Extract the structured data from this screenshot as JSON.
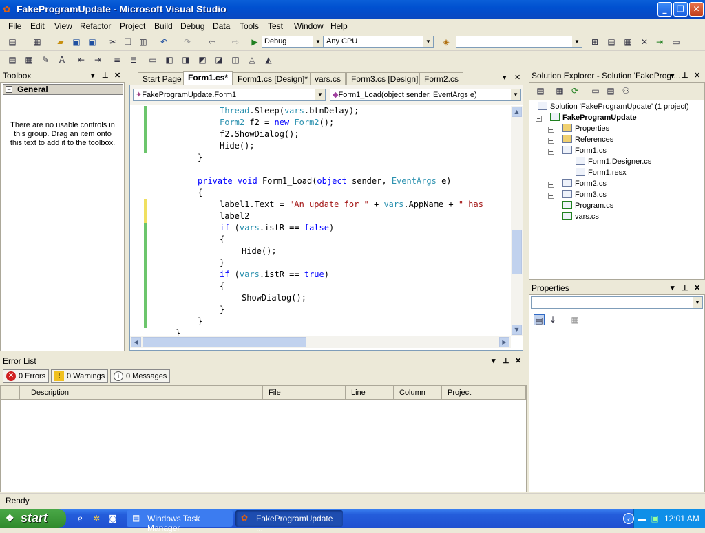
{
  "window": {
    "title": "FakeProgramUpdate - Microsoft Visual Studio",
    "minimize": "_",
    "maximize": "❐",
    "close": "✕"
  },
  "menu": [
    "File",
    "Edit",
    "View",
    "Refactor",
    "Project",
    "Build",
    "Debug",
    "Data",
    "Tools",
    "Test",
    "Window",
    "Help"
  ],
  "toolbar": {
    "config": "Debug",
    "platform": "Any CPU",
    "find": ""
  },
  "toolbox": {
    "title": "Toolbox",
    "group": "General",
    "message": "There are no usable controls in this group. Drag an item onto this text to add it to the toolbox."
  },
  "tabs": [
    "Start Page",
    "Form1.cs*",
    "Form1.cs [Design]*",
    "vars.cs",
    "Form3.cs [Design]",
    "Form2.cs"
  ],
  "editor": {
    "class_combo": "FakeProgramUpdate.Form1",
    "member_combo": "Form1_Load(object sender, EventArgs e)",
    "lines": [
      [
        [
          "ty",
          "Thread"
        ],
        [
          "",
          "."
        ],
        [
          "",
          "Sleep("
        ],
        [
          "ty",
          "vars"
        ],
        [
          "",
          ".btnDelay);"
        ]
      ],
      [
        [
          "ty",
          "Form2"
        ],
        [
          "",
          " f2 = "
        ],
        [
          "kw",
          "new"
        ],
        [
          "",
          " "
        ],
        [
          "ty",
          "Form2"
        ],
        [
          "",
          "();"
        ]
      ],
      [
        [
          "",
          "f2.ShowDialog();"
        ]
      ],
      [
        [
          "",
          "Hide();"
        ]
      ],
      [
        [
          "",
          "}"
        ]
      ],
      [
        [
          "",
          ""
        ]
      ],
      [
        [
          "kw",
          "private"
        ],
        [
          "",
          " "
        ],
        [
          "kw",
          "void"
        ],
        [
          "",
          " Form1_Load("
        ],
        [
          "kw",
          "object"
        ],
        [
          "",
          " sender, "
        ],
        [
          "ty",
          "EventArgs"
        ],
        [
          "",
          " e)"
        ]
      ],
      [
        [
          "",
          "{"
        ]
      ],
      [
        [
          "",
          "label1.Text = "
        ],
        [
          "st",
          "\"An update for \""
        ],
        [
          "",
          " + "
        ],
        [
          "ty",
          "vars"
        ],
        [
          "",
          ".AppName + "
        ],
        [
          "st",
          "\" has"
        ]
      ],
      [
        [
          "",
          "label2"
        ]
      ],
      [
        [
          "kw",
          "if"
        ],
        [
          "",
          " ("
        ],
        [
          "ty",
          "vars"
        ],
        [
          "",
          ".istR == "
        ],
        [
          "kw",
          "false"
        ],
        [
          "",
          ")"
        ]
      ],
      [
        [
          "",
          "{"
        ]
      ],
      [
        [
          "",
          "Hide();"
        ]
      ],
      [
        [
          "",
          "}"
        ]
      ],
      [
        [
          "kw",
          "if"
        ],
        [
          "",
          " ("
        ],
        [
          "ty",
          "vars"
        ],
        [
          "",
          ".istR == "
        ],
        [
          "kw",
          "true"
        ],
        [
          "",
          ")"
        ]
      ],
      [
        [
          "",
          "{"
        ]
      ],
      [
        [
          "",
          "ShowDialog();"
        ]
      ],
      [
        [
          "",
          "}"
        ]
      ],
      [
        [
          "",
          "}"
        ]
      ],
      [
        [
          "",
          "}"
        ]
      ]
    ]
  },
  "error_list": {
    "title": "Error List",
    "errors": "0 Errors",
    "warnings": "0 Warnings",
    "messages": "0 Messages",
    "columns": [
      "Description",
      "File",
      "Line",
      "Column",
      "Project"
    ]
  },
  "solution_explorer": {
    "title": "Solution Explorer - Solution 'FakeProgr...",
    "tree": [
      "Solution 'FakeProgramUpdate' (1 project)",
      "FakeProgramUpdate",
      "Properties",
      "References",
      "Form1.cs",
      "Form1.Designer.cs",
      "Form1.resx",
      "Form2.cs",
      "Form3.cs",
      "Program.cs",
      "vars.cs"
    ]
  },
  "properties": {
    "title": "Properties"
  },
  "status": {
    "text": "Ready"
  },
  "taskbar": {
    "start": "start",
    "tasks": [
      "Windows Task Manager",
      "FakeProgramUpdate ..."
    ],
    "clock": "12:01 AM"
  }
}
